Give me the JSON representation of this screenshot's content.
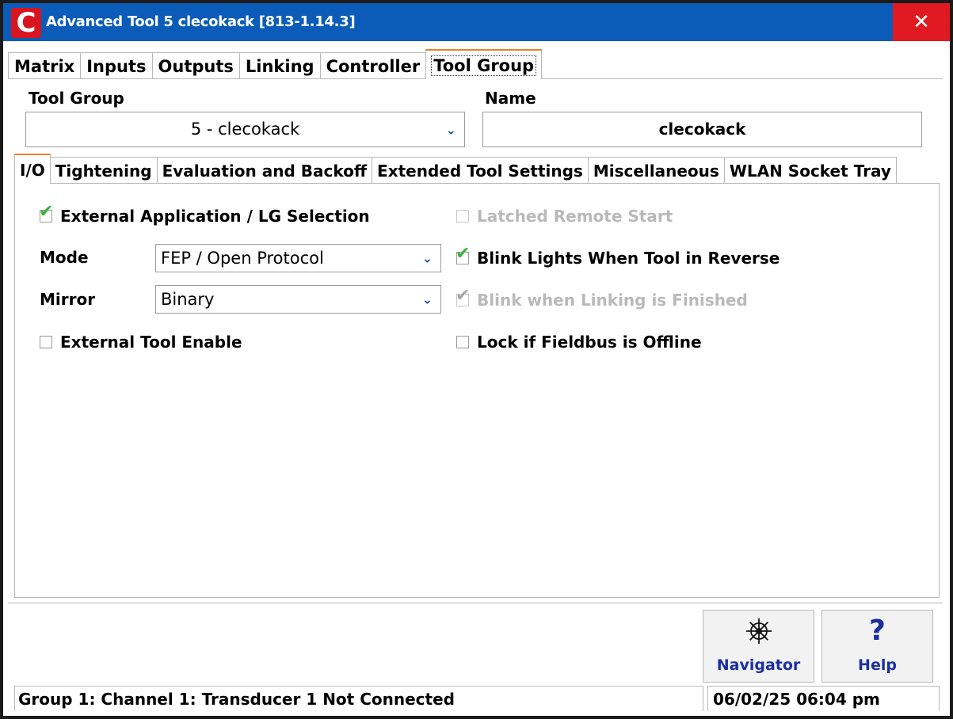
{
  "window": {
    "title": "Advanced  Tool 5  clecokack [813-1.14.3]",
    "close_icon": "close-icon",
    "app_icon_letter": "C",
    "accent_color": "#0a5cb8",
    "close_color": "#e11a22"
  },
  "top_tabs": [
    {
      "label": "Matrix"
    },
    {
      "label": "Inputs"
    },
    {
      "label": "Outputs"
    },
    {
      "label": "Linking"
    },
    {
      "label": "Controller"
    },
    {
      "label": "Tool Group",
      "active": true
    }
  ],
  "tool_group": {
    "label": "Tool Group",
    "value": "5 - clecokack"
  },
  "name": {
    "label": "Name",
    "value": "clecokack"
  },
  "sub_tabs": [
    {
      "label": "I/O",
      "active": true
    },
    {
      "label": "Tightening"
    },
    {
      "label": "Evaluation and Backoff"
    },
    {
      "label": "Extended Tool Settings"
    },
    {
      "label": "Miscellaneous"
    },
    {
      "label": "WLAN Socket Tray"
    }
  ],
  "io": {
    "external_app": {
      "label": "External Application / LG Selection",
      "checked": true
    },
    "mode": {
      "label": "Mode",
      "value": "FEP / Open Protocol"
    },
    "mirror": {
      "label": "Mirror",
      "value": "Binary"
    },
    "external_tool_enable": {
      "label": "External Tool Enable",
      "checked": false
    },
    "latched_remote_start": {
      "label": "Latched Remote Start",
      "checked": false,
      "disabled": true
    },
    "blink_reverse": {
      "label": "Blink Lights When Tool in Reverse",
      "checked": true
    },
    "blink_linking": {
      "label": "Blink when Linking is Finished",
      "checked": true,
      "disabled": true
    },
    "lock_fieldbus": {
      "label": "Lock if Fieldbus is Offline",
      "checked": false
    }
  },
  "buttons": {
    "navigator": {
      "label": "Navigator",
      "icon": "ship-wheel-icon"
    },
    "help": {
      "label": "Help",
      "icon": "question-icon"
    }
  },
  "status": {
    "message": "Group 1: Channel 1: Transducer 1 Not Connected",
    "datetime": "06/02/25 06:04 pm"
  }
}
